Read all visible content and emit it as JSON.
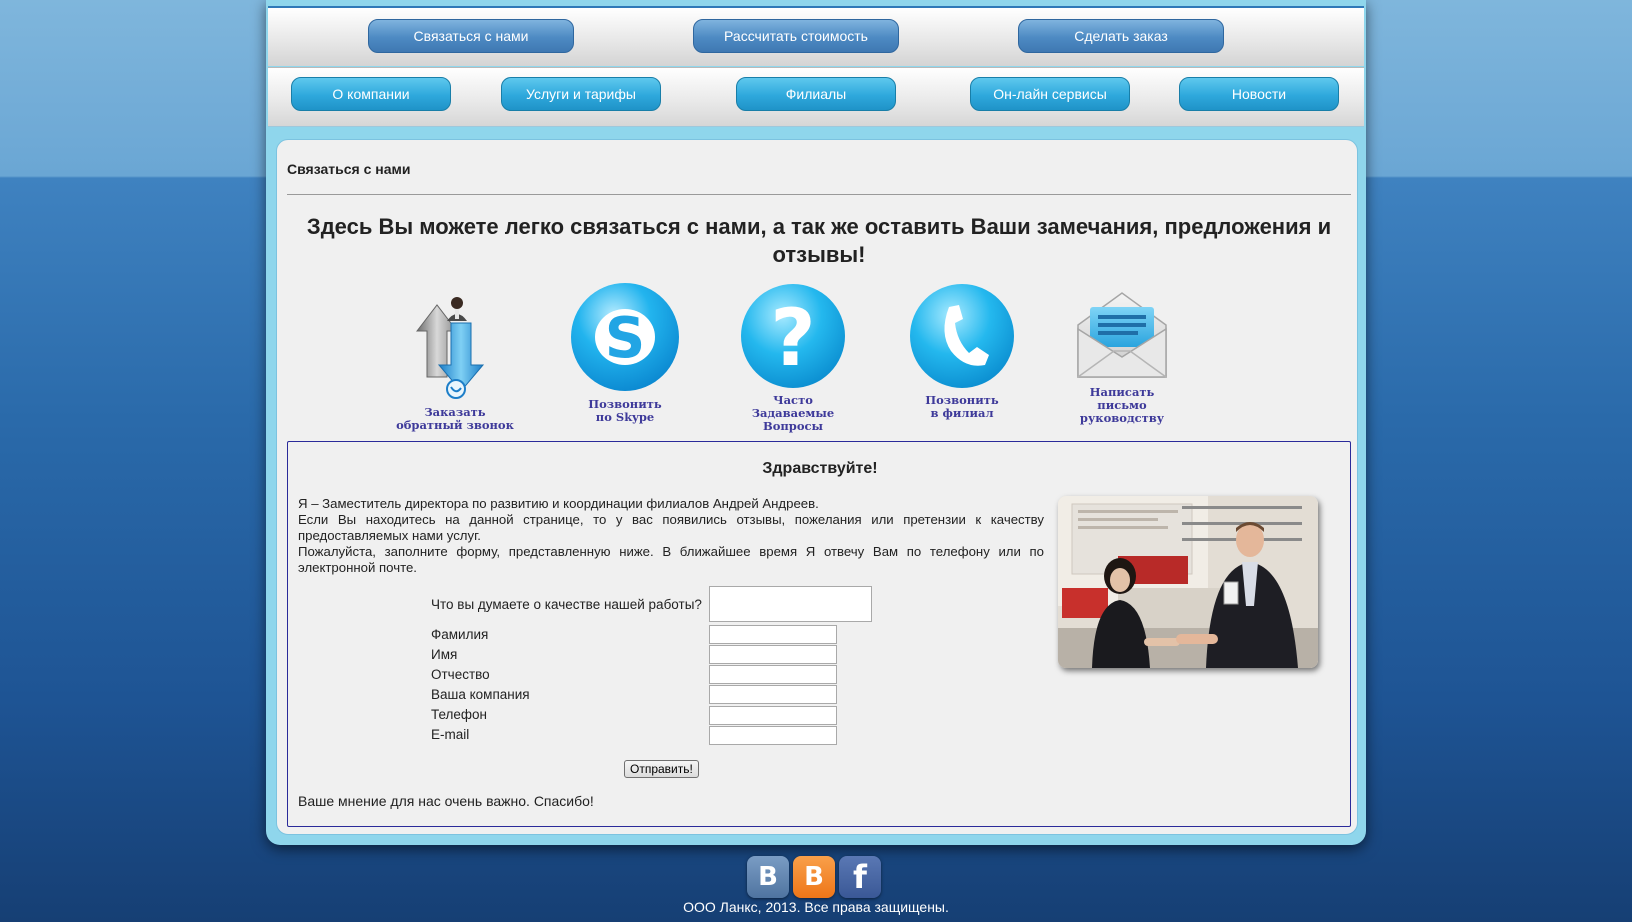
{
  "nav_top": [
    "Связаться с нами",
    "Рассчитать стоимость",
    "Сделать заказ"
  ],
  "nav_main": [
    "О компании",
    "Услуги и тарифы",
    "Филиалы",
    "Он-лайн сервисы",
    "Новости"
  ],
  "section_title": "Связаться с нами",
  "headline": "Здесь Вы можете легко связаться с нами, а так же оставить Ваши замечания, предложения и отзывы!",
  "contact_icons": [
    {
      "icon": "callback-arrows-icon",
      "caption_lines": [
        "Заказать",
        "обратный звонок"
      ]
    },
    {
      "icon": "skype-icon",
      "caption_lines": [
        "Позвонить",
        "по Skype"
      ]
    },
    {
      "icon": "question-icon",
      "caption_lines": [
        "Часто",
        "Задаваемые",
        "Вопросы"
      ]
    },
    {
      "icon": "phone-icon",
      "caption_lines": [
        "Позвонить",
        "в филиал"
      ]
    },
    {
      "icon": "envelope-icon",
      "caption_lines": [
        "Написать",
        "письмо",
        "руководству"
      ]
    }
  ],
  "greeting": "Здравствуйте!",
  "intro_lines": [
    "Я – Заместитель директора по развитию и координации филиалов Андрей Андреев.",
    "Если Вы находитесь на данной странице, то у вас появились отзывы, пожелания или претензии к качеству предоставляемых нами услуг.",
    "Пожалуйста, заполните форму, представленную ниже. В ближайшее время Я отвечу Вам по телефону или по электронной почте."
  ],
  "form": {
    "question_label": "Что вы думаете о качестве нашей работы?",
    "question_value": "",
    "fields": [
      {
        "label": "Фамилия",
        "value": ""
      },
      {
        "label": "Имя",
        "value": ""
      },
      {
        "label": "Отчество",
        "value": ""
      },
      {
        "label": "Ваша компания",
        "value": ""
      },
      {
        "label": "Телефон",
        "value": ""
      },
      {
        "label": "E-mail",
        "value": ""
      }
    ],
    "submit_label": "Отправить!"
  },
  "closing": "Ваше мнение для нас очень важно. Спасибо!",
  "social": [
    {
      "icon": "vk-icon",
      "glyph": "B",
      "color": "#5b7fa8"
    },
    {
      "icon": "blogger-icon",
      "glyph": "B",
      "color": "#f27d1f"
    },
    {
      "icon": "facebook-icon",
      "glyph": "f",
      "color": "#3b5998"
    }
  ],
  "footer": "ООО Ланкс, 2013. Все права защищены."
}
